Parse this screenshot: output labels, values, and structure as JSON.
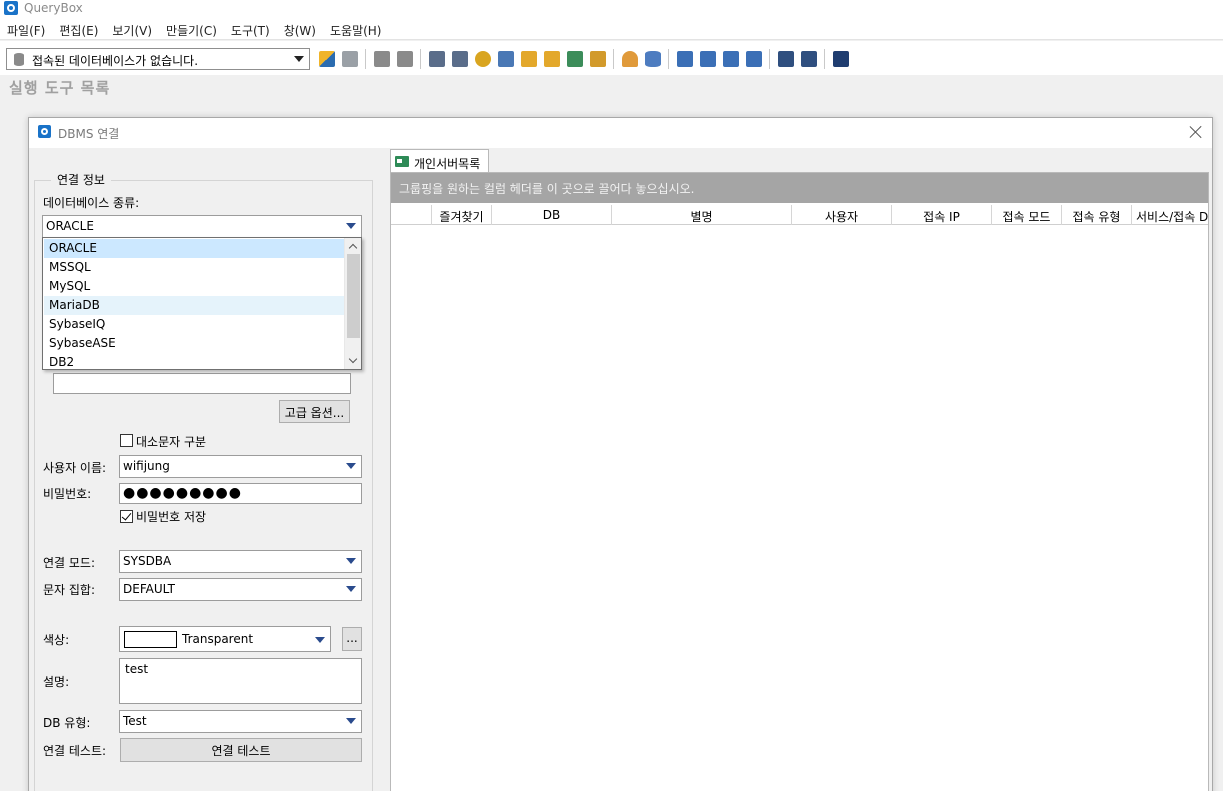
{
  "app": {
    "title": "QueryBox"
  },
  "menu": [
    "파일(F)",
    "편집(E)",
    "보기(V)",
    "만들기(C)",
    "도구(T)",
    "창(W)",
    "도움말(H)"
  ],
  "toolbar": {
    "connection_combo": "접속된 데이터베이스가 없습니다.",
    "icons": [
      "connect-icon",
      "disconnect-icon",
      "sql-open-icon",
      "sql-save-icon",
      "query-icon",
      "query-copy-icon",
      "search-objects-icon",
      "table-icon",
      "db-lock-icon",
      "db-export-icon",
      "refresh-icon",
      "transfer-icon",
      "user-icon",
      "db-icon",
      "monitor-icon",
      "session-icon",
      "lock-monitor-icon",
      "sql-monitor-icon",
      "layout-icon",
      "table-view-icon",
      "tools-icon"
    ]
  },
  "panel_label": "실행 도구 목록",
  "dialog": {
    "title": "DBMS 연결",
    "group_title": "연결 정보",
    "db_type_label": "데이터베이스 종류:",
    "db_type_value": "ORACLE",
    "db_type_options": [
      "ORACLE",
      "MSSQL",
      "MySQL",
      "MariaDB",
      "SybaseIQ",
      "SybaseASE",
      "DB2"
    ],
    "advanced_button": "고급 옵션...",
    "case_sensitive_label": "대소문자 구분",
    "username_label": "사용자 이름:",
    "username_value": "wifijung",
    "password_label": "비밀번호:",
    "password_value": "●●●●●●●●●",
    "save_password_label": "비밀번호 저장",
    "conn_mode_label": "연결 모드:",
    "conn_mode_value": "SYSDBA",
    "charset_label": "문자 집합:",
    "charset_value": "DEFAULT",
    "color_label": "색상:",
    "color_value": "Transparent",
    "color_more_button": "...",
    "desc_label": "설명:",
    "desc_value": "test",
    "dbtype_label": "DB 유형:",
    "dbtype_value": "Test",
    "conn_test_label": "연결 테스트:",
    "conn_test_button": "연결 테스트"
  },
  "server_panel": {
    "tab_label": "개인서버목록",
    "group_hint": "그룹핑을 원하는 컬럼 헤더를 이 곳으로 끌어다 놓으십시오.",
    "columns": [
      "",
      "즐겨찾기",
      "DB",
      "별명",
      "사용자",
      "접속 IP",
      "접속 모드",
      "접속 유형",
      "서비스/접속 DB"
    ]
  }
}
